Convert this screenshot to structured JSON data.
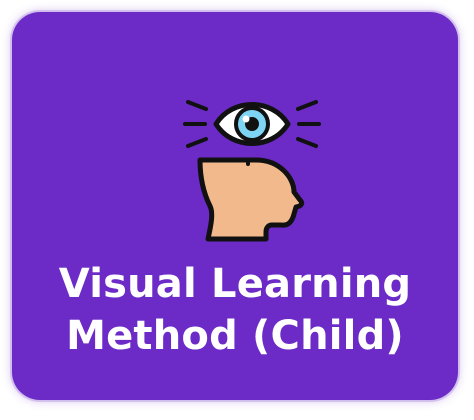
{
  "card": {
    "title_line1": "Visual Learning",
    "title_line2": "Method (Child)",
    "background_color": "#6c2bc7",
    "text_color": "#ffffff",
    "icon": "visual-learning-head-eye-icon"
  }
}
